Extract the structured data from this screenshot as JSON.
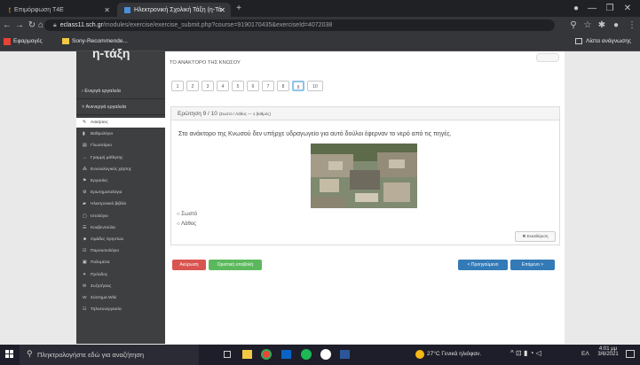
{
  "browser": {
    "tabs": [
      {
        "title": "Επιμόρφωση Τ4Ε"
      },
      {
        "title": "Ηλεκτρονική Σχολική Τάξη (η-Τά"
      }
    ],
    "url_host": "eclass11.sch.gr",
    "url_path": "/modules/exercise/exercise_submit.php?course=9190170435&exerciseId=4072038",
    "bookmarks": [
      "Εφαρμογές",
      "Sony-Recommende..."
    ],
    "reading_list": "Λίστα ανάγνωσης"
  },
  "sidebar": {
    "logo": "η-τάξη",
    "sections": [
      {
        "label": "Ενεργά εργαλεία"
      },
      {
        "label": "Ανενεργά εργαλεία"
      }
    ],
    "items": [
      {
        "label": "Ασκήσεις",
        "icon": "✎"
      },
      {
        "label": "Βαθμολόγιο",
        "icon": "▮"
      },
      {
        "label": "Γλωσσάριο",
        "icon": "▤"
      },
      {
        "label": "Γραμμή μάθησης",
        "icon": "↔"
      },
      {
        "label": "Εννοιολογικός χάρτης",
        "icon": "⁂"
      },
      {
        "label": "Εργασίες",
        "icon": "⚑"
      },
      {
        "label": "Ερωτηματολόγια",
        "icon": "⚙"
      },
      {
        "label": "Ηλεκτρονικό βιβλίο",
        "icon": "▰"
      },
      {
        "label": "Ιστολόγιο",
        "icon": "▢"
      },
      {
        "label": "Κουβεντούλα",
        "icon": "☰"
      },
      {
        "label": "Ομάδες Χρηστών",
        "icon": "☻"
      },
      {
        "label": "Παρουσιολόγιο",
        "icon": "☑"
      },
      {
        "label": "Πολυμέσα",
        "icon": "▣"
      },
      {
        "label": "Πρόοδος",
        "icon": "✦"
      },
      {
        "label": "Συζητήσεις",
        "icon": "✉"
      },
      {
        "label": "Σύστημα Wiki",
        "icon": "W"
      },
      {
        "label": "Τηλεσυνεργασία",
        "icon": "☷"
      }
    ]
  },
  "exercise": {
    "title": "ΤΟ ΑΝΑΚΤΟΡΟ ΤΗΣ ΚΝΩΣΟΥ",
    "pages": [
      "1",
      "2",
      "3",
      "4",
      "5",
      "6",
      "7",
      "8",
      "9",
      "10"
    ],
    "current_page": "9",
    "question_header": "Ερώτηση 9 / 10",
    "question_meta": "(Σωστό / Λάθος — 1 βαθμός)",
    "question_text": "Στο ανάκτορο της Κνωσού δεν υπήρχε υδραγωγείο για αυτό δούλοι έφερναν το νερό από τις πηγές.",
    "options": [
      "Σωστό",
      "Λάθος"
    ],
    "clear_label": "✖ Εκκαθάριση",
    "cancel_label": "Ακύρωση",
    "temp_submit_label": "Οριστική υποβολή",
    "prev_label": "< Προηγούμενο",
    "next_label": "Επόμενο >"
  },
  "taskbar": {
    "search_placeholder": "Πληκτρολογήστε εδώ για αναζήτηση",
    "weather": "27°C Γενικά ηλιόφαν.",
    "lang": "ΕΛ",
    "time": "4:01 μμ",
    "date": "3/6/2021"
  },
  "colors": {
    "danger": "#d9534f",
    "success": "#5cb85c",
    "primary": "#337ab7"
  }
}
